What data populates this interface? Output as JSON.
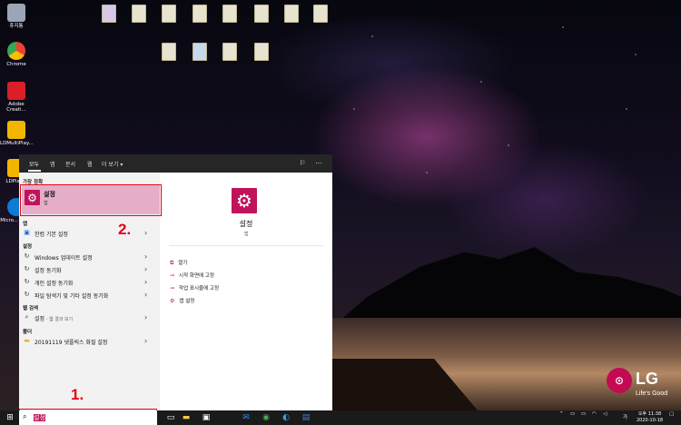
{
  "desktop": {
    "icons": [
      {
        "label": "휴지통",
        "icon": "recycle-bin-icon",
        "color": "#9aa6b5"
      },
      {
        "label": "Chrome",
        "icon": "chrome-icon",
        "color": "#4285f4"
      },
      {
        "label": "Adobe Creati...",
        "icon": "adobe-cc-icon",
        "color": "#da1f26"
      },
      {
        "label": "LDMultiPlay...",
        "icon": "ldmultiplayer-icon",
        "color": "#f2b600"
      },
      {
        "label": "LDPlay...",
        "icon": "ldplayer-icon",
        "color": "#f2b600"
      },
      {
        "label": "Micro... Edge",
        "icon": "edge-icon",
        "color": "#0c7cd5"
      }
    ],
    "brand": {
      "logo": "LG",
      "slogan": "Life's Good",
      "color": "#c40a52"
    }
  },
  "search_panel": {
    "tabs": [
      "모두",
      "앱",
      "문서",
      "웹",
      "더 보기 ▾"
    ],
    "section_best": "가장 정확",
    "best_match": {
      "title": "설정",
      "subtitle": "앱"
    },
    "section_app": "앱",
    "app_items": [
      {
        "label": "한컴 기본 설정"
      }
    ],
    "section_settings": "설정",
    "settings_items": [
      {
        "label": "Windows 업데이트 설정"
      },
      {
        "label": "설정 동기화"
      },
      {
        "label": "개인 설정 동기화"
      },
      {
        "label": "파일 탐색기 및 기타 설정 동기화"
      }
    ],
    "section_web": "웹 검색",
    "web_item": {
      "label": "설정",
      "suffix": " - 웹 결과 보기"
    },
    "section_folder": "폴더",
    "folder_item": {
      "label": "20191119 넷플릭스 화질 설정"
    },
    "detail": {
      "title": "설정",
      "subtitle": "앱",
      "actions": [
        {
          "label": "열기",
          "icon": "open-icon"
        },
        {
          "label": "시작 화면에 고정",
          "icon": "pin-start-icon"
        },
        {
          "label": "작업 표시줄에 고정",
          "icon": "pin-taskbar-icon"
        },
        {
          "label": "앱 설정",
          "icon": "app-settings-icon"
        }
      ]
    },
    "accent": "#c1135b"
  },
  "annotations": {
    "step1": "1.",
    "step2": "2."
  },
  "taskbar": {
    "search_text": "설정",
    "tray_ime": "가",
    "time": "오후 11:38",
    "date": "2020-10-18"
  }
}
